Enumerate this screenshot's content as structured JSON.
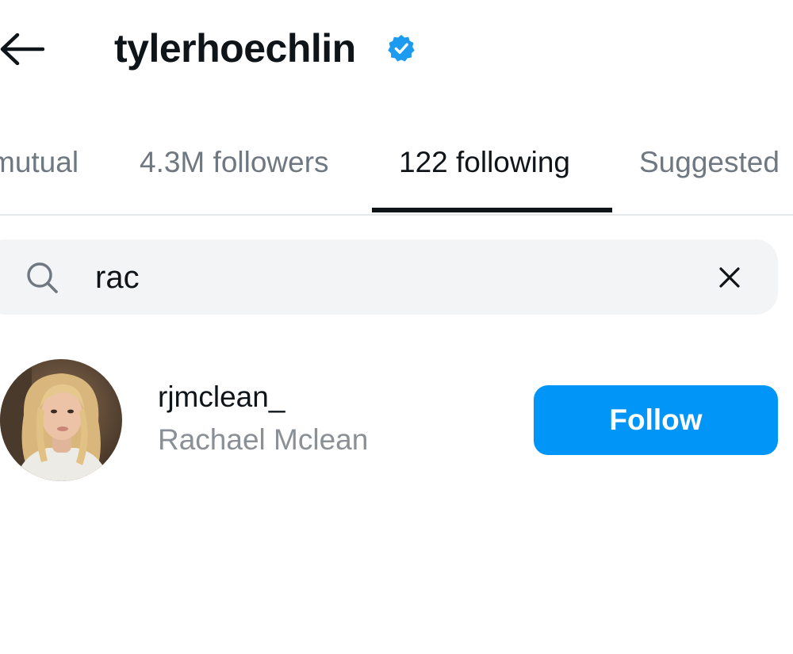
{
  "header": {
    "username": "tylerhoechlin",
    "verified": true,
    "back_icon": "arrow-left-icon",
    "verified_icon": "verified-badge-icon"
  },
  "tabs": [
    {
      "label": "mutual",
      "active": false
    },
    {
      "label": "4.3M followers",
      "active": false
    },
    {
      "label": "122 following",
      "active": true
    },
    {
      "label": "Suggested",
      "active": false
    }
  ],
  "search": {
    "value": "rac",
    "icon": "search-icon",
    "clear_icon": "close-icon"
  },
  "results": [
    {
      "handle": "rjmclean_",
      "name": "Rachael Mclean",
      "button_label": "Follow"
    }
  ],
  "colors": {
    "accent": "#0095f6",
    "verified": "#1d9bf0",
    "text": "#0f1419",
    "muted": "#8a9096",
    "search_bg": "#f3f4f6"
  }
}
